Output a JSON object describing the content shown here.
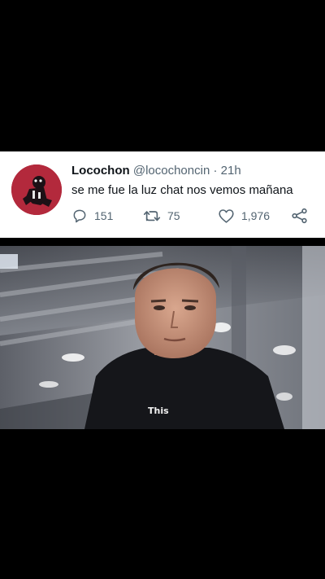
{
  "tweet": {
    "author_name": "Locochon",
    "author_handle": "@locochoncin",
    "separator": "·",
    "time": "21h",
    "text": "se me fue la luz chat nos vemos mañana",
    "replies": "151",
    "retweets": "75",
    "likes": "1,976",
    "icons": {
      "reply": "reply-icon",
      "retweet": "retweet-icon",
      "like": "heart-icon",
      "share": "share-icon"
    }
  },
  "video": {
    "subtitle": "This"
  }
}
